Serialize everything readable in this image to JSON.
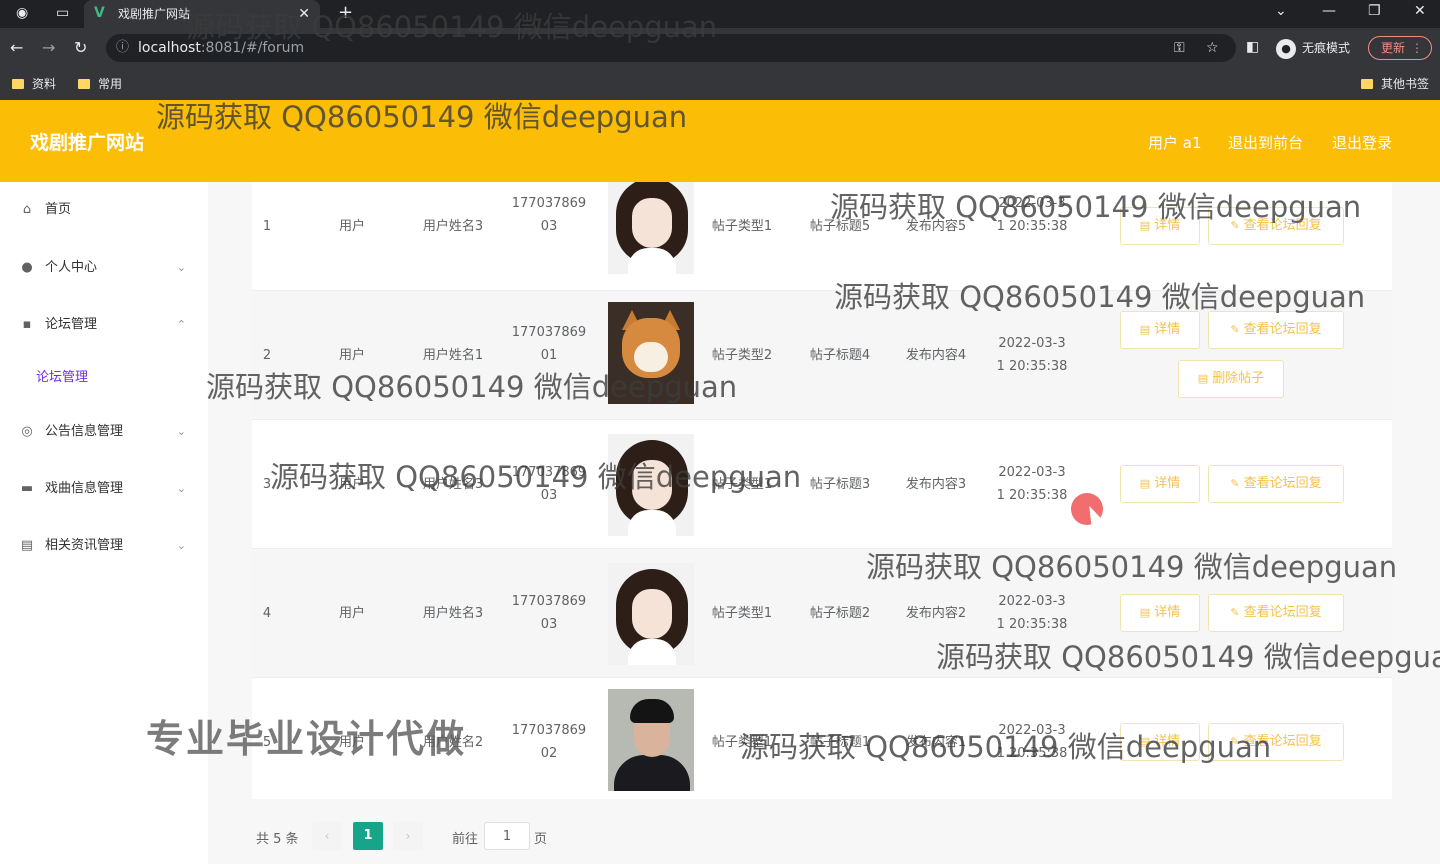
{
  "browser": {
    "tab_title": "戏剧推广网站",
    "url_host": "localhost",
    "url_rest": ":8081/#/forum",
    "incognito_label": "无痕模式",
    "update_label": "更新",
    "bookmarks": [
      "资料",
      "常用"
    ],
    "other_bookmarks": "其他书签"
  },
  "header": {
    "site_title": "戏剧推广网站",
    "user_label": "用户 a1",
    "front_label": "退出到前台",
    "logout_label": "退出登录",
    "bg_color": "#fbbd05"
  },
  "sidebar": {
    "items": [
      {
        "label": "首页",
        "icon": "home-icon"
      },
      {
        "label": "个人中心",
        "icon": "user-icon"
      },
      {
        "label": "论坛管理",
        "icon": "chat-icon"
      },
      {
        "label": "论坛管理",
        "icon": ""
      },
      {
        "label": "公告信息管理",
        "icon": "compass-icon"
      },
      {
        "label": "戏曲信息管理",
        "icon": "monitor-icon"
      },
      {
        "label": "相关资讯管理",
        "icon": "clipboard-icon"
      }
    ],
    "active_color": "#6e2fe4"
  },
  "table": {
    "rows": [
      {
        "index": "1",
        "type": "用户",
        "name": "用户姓名3",
        "phone_a": "177037869",
        "phone_b": "03",
        "avatar": "girl",
        "post_type": "帖子类型1",
        "post_title": "帖子标题5",
        "content": "发布内容5",
        "time_a": "2022-03-3",
        "time_b": "1 20:35:38"
      },
      {
        "index": "2",
        "type": "用户",
        "name": "用户姓名1",
        "phone_a": "177037869",
        "phone_b": "01",
        "avatar": "dog",
        "post_type": "帖子类型2",
        "post_title": "帖子标题4",
        "content": "发布内容4",
        "time_a": "2022-03-3",
        "time_b": "1 20:35:38"
      },
      {
        "index": "3",
        "type": "用户",
        "name": "用户姓名3",
        "phone_a": "177037869",
        "phone_b": "03",
        "avatar": "girl",
        "post_type": "帖子类型1",
        "post_title": "帖子标题3",
        "content": "发布内容3",
        "time_a": "2022-03-3",
        "time_b": "1 20:35:38"
      },
      {
        "index": "4",
        "type": "用户",
        "name": "用户姓名3",
        "phone_a": "177037869",
        "phone_b": "03",
        "avatar": "girl",
        "post_type": "帖子类型1",
        "post_title": "帖子标题2",
        "content": "发布内容2",
        "time_a": "2022-03-3",
        "time_b": "1 20:35:38"
      },
      {
        "index": "5",
        "type": "用户",
        "name": "用户姓名2",
        "phone_a": "177037869",
        "phone_b": "02",
        "avatar": "man",
        "post_type": "帖子类型1",
        "post_title": "帖子标题1",
        "content": "发布内容1",
        "time_a": "2022-03-3",
        "time_b": "1 20:35:38"
      }
    ],
    "btn_detail": "详情",
    "btn_view_reply": "查看论坛回复",
    "btn_delete": "删除帖子"
  },
  "pagination": {
    "total": "共 5 条",
    "current": "1",
    "goto": "前往",
    "goto_value": "1",
    "unit": "页"
  },
  "watermarks": {
    "text": "源码获取 QQ86050149 微信deepguan",
    "big": "专业毕业设计代做"
  }
}
